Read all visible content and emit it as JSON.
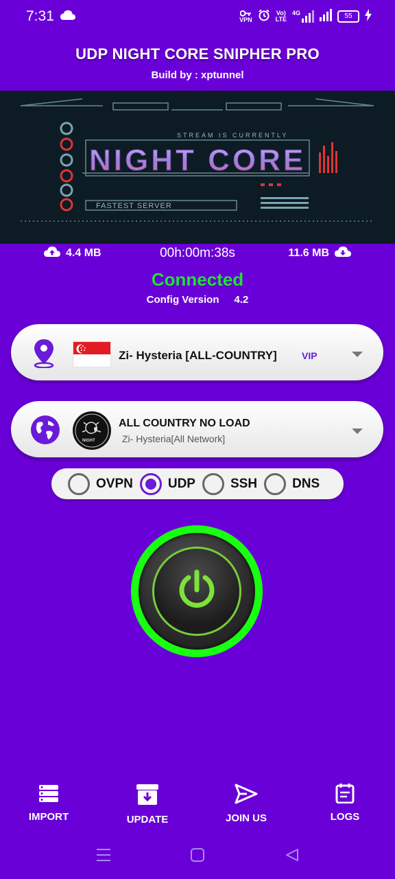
{
  "status_bar": {
    "time": "7:31",
    "vpn": "VPN",
    "vo": "Vo)",
    "lte": "LTE",
    "net": "4G",
    "battery": "55"
  },
  "header": {
    "title": "UDP NIGHT CORE SNIPHER PRO",
    "subtitle": "Build by : xptunnel"
  },
  "banner": {
    "top_text": "STREAM IS CURRENTLY",
    "logo_text": "NIGHT CORE",
    "bottom_text": "FASTEST SERVER"
  },
  "stats": {
    "upload": "4.4 MB",
    "duration": "00h:00m:38s",
    "download": "11.6 MB"
  },
  "connection": {
    "status": "Connected",
    "status_color": "#22e03a",
    "config_label": "Config Version",
    "config_version": "4.2"
  },
  "server": {
    "name": "Zi- Hysteria [ALL-COUNTRY]",
    "badge": "VIP",
    "icon": "location-pin-icon"
  },
  "network": {
    "title": "ALL COUNTRY NO LOAD",
    "subtitle": "Zi- Hysteria[All Network]",
    "logo_text": "NIGHT",
    "icon": "globe-icon"
  },
  "protocols": {
    "options": [
      "OVPN",
      "UDP",
      "SSH",
      "DNS"
    ],
    "selected": "UDP"
  },
  "bottom_nav": {
    "import": "IMPORT",
    "update": "UPDATE",
    "join": "JOIN US",
    "logs": "LOGS"
  },
  "colors": {
    "background": "#6a00d8",
    "accent": "#6a1bd8",
    "power_ring": "#19ff12"
  }
}
